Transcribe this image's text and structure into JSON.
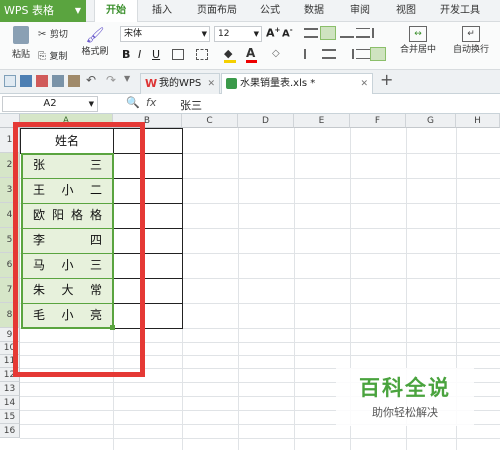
{
  "app": {
    "name": "WPS 表格"
  },
  "menu": [
    "开始",
    "插入",
    "页面布局",
    "公式",
    "数据",
    "审阅",
    "视图",
    "开发工具"
  ],
  "ribbon": {
    "paste": "粘贴",
    "cut": "剪切",
    "copy": "复制",
    "format_painter": "格式刷",
    "font_name": "宋体",
    "font_size": "12",
    "merge_center": "合并居中",
    "wrap_text": "自动换行"
  },
  "tabs": {
    "home_tab": "我的WPS",
    "file_tab": "水果销量表.xls *"
  },
  "formula_bar": {
    "name_box": "A2",
    "fx": "fx",
    "value": "张三"
  },
  "columns": [
    "A",
    "B",
    "C",
    "D",
    "E",
    "F",
    "G",
    "H"
  ],
  "rows": [
    "1",
    "2",
    "3",
    "4",
    "5",
    "6",
    "7",
    "8",
    "9",
    "10",
    "11",
    "12",
    "13",
    "14",
    "15",
    "16"
  ],
  "sheet": {
    "header": "姓名",
    "names": [
      [
        "张",
        "三"
      ],
      [
        "王",
        "小",
        "二"
      ],
      [
        "欧",
        "阳",
        "格",
        "格"
      ],
      [
        "李",
        "四"
      ],
      [
        "马",
        "小",
        "三"
      ],
      [
        "朱",
        "大",
        "常"
      ],
      [
        "毛",
        "小",
        "亮"
      ]
    ]
  },
  "watermark": {
    "title": "百科全说",
    "subtitle": "助你轻松解决"
  },
  "colors": {
    "accent": "#5aa43f",
    "highlight_border": "#e53935",
    "cell_fill": "#e7f1dc"
  }
}
